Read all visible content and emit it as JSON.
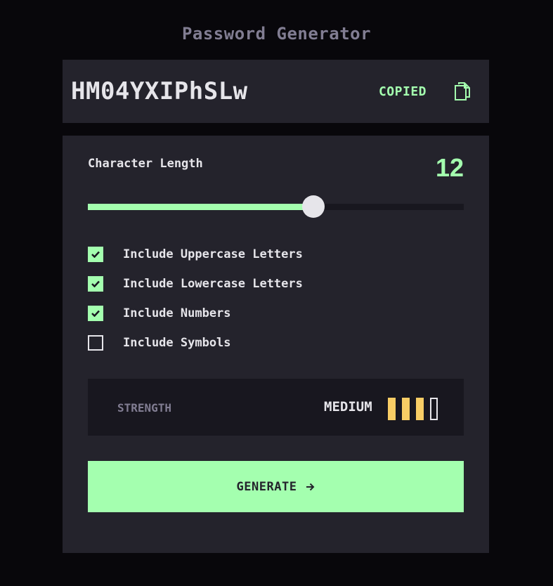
{
  "header": {
    "title": "Password Generator"
  },
  "output": {
    "password": "HM04YXIPhSLw",
    "copied_label": "COPIED",
    "copy_icon": "copy-icon"
  },
  "length": {
    "label": "Character Length",
    "value": "12",
    "min": 0,
    "max": 20,
    "current": 12
  },
  "options": [
    {
      "label": "Include Uppercase Letters",
      "checked": true
    },
    {
      "label": "Include Lowercase Letters",
      "checked": true
    },
    {
      "label": "Include Numbers",
      "checked": true
    },
    {
      "label": "Include Symbols",
      "checked": false
    }
  ],
  "strength": {
    "label": "STRENGTH",
    "level": "MEDIUM",
    "filled_bars": 3,
    "total_bars": 4
  },
  "generate": {
    "label": "GENERATE",
    "icon": "arrow-right-icon"
  },
  "colors": {
    "accent": "#a4ffaf",
    "panel": "#24232c",
    "background": "#08070b",
    "medium_strength": "#f8cd65"
  }
}
